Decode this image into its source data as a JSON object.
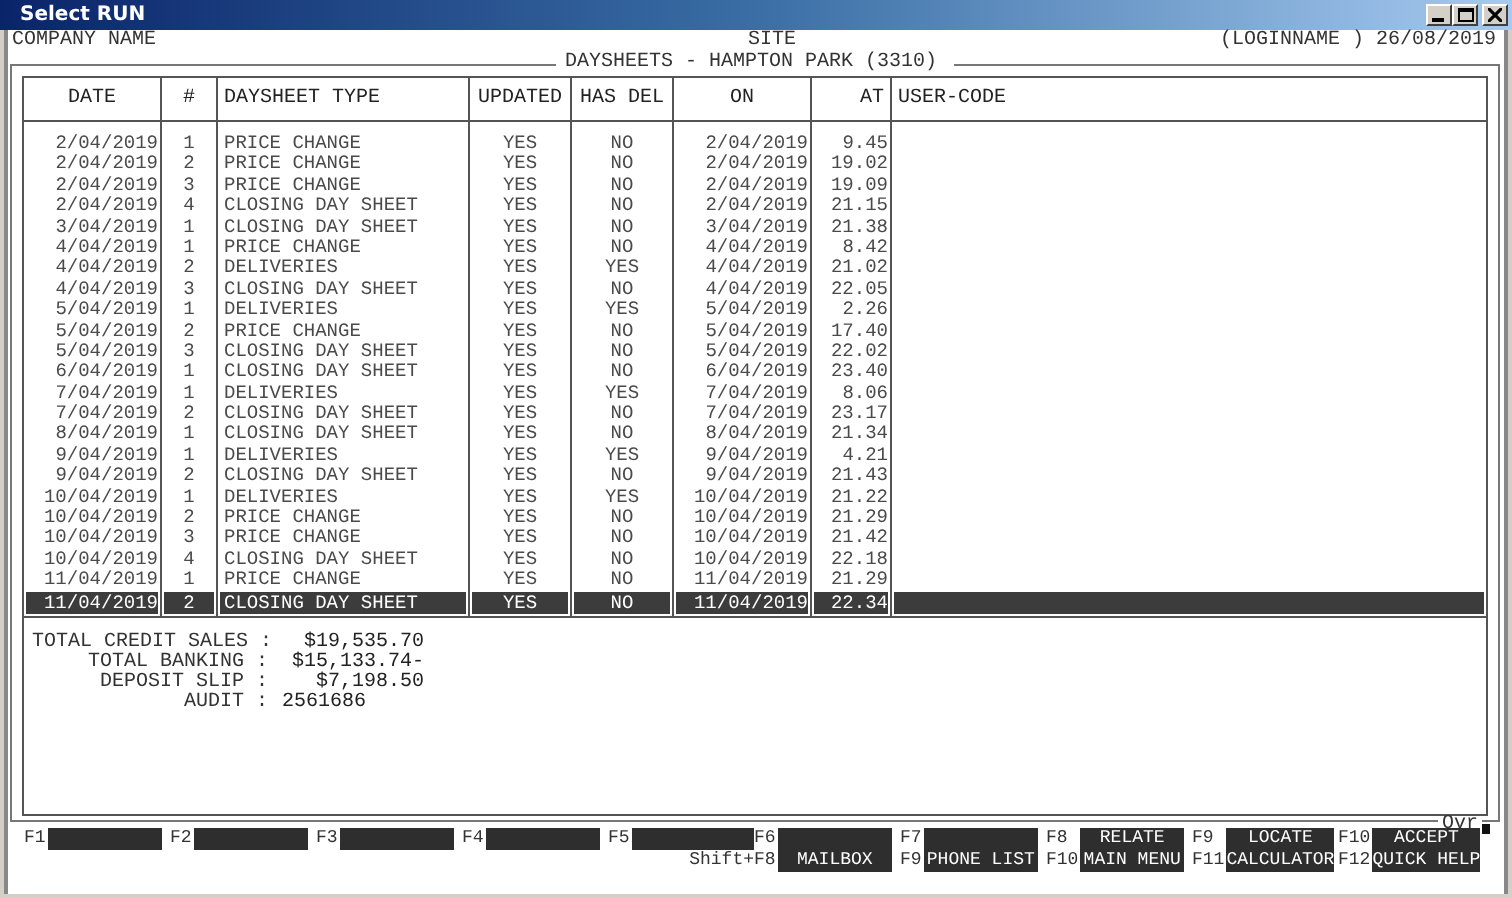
{
  "window": {
    "title": "Select RUN"
  },
  "header": {
    "company": "COMPANY NAME",
    "site": "SITE",
    "user": "(LOGINNAME )",
    "date": "26/08/2019"
  },
  "panel": {
    "title": "DAYSHEETS - HAMPTON PARK (3310)",
    "mode": "Ovr",
    "columns": [
      "DATE",
      "#",
      "DAYSHEET TYPE",
      "UPDATED",
      "HAS DEL",
      "ON",
      "AT",
      "USER-CODE"
    ],
    "rows": [
      {
        "date": "2/04/2019",
        "number": "1",
        "type": "PRICE CHANGE",
        "updated": "YES",
        "has_del": "NO",
        "on": "2/04/2019",
        "at": "9.45",
        "selected": false
      },
      {
        "date": "2/04/2019",
        "number": "2",
        "type": "PRICE CHANGE",
        "updated": "YES",
        "has_del": "NO",
        "on": "2/04/2019",
        "at": "19.02",
        "selected": false
      },
      {
        "date": "2/04/2019",
        "number": "3",
        "type": "PRICE CHANGE",
        "updated": "YES",
        "has_del": "NO",
        "on": "2/04/2019",
        "at": "19.09",
        "selected": false
      },
      {
        "date": "2/04/2019",
        "number": "4",
        "type": "CLOSING DAY SHEET",
        "updated": "YES",
        "has_del": "NO",
        "on": "2/04/2019",
        "at": "21.15",
        "selected": false
      },
      {
        "date": "3/04/2019",
        "number": "1",
        "type": "CLOSING DAY SHEET",
        "updated": "YES",
        "has_del": "NO",
        "on": "3/04/2019",
        "at": "21.38",
        "selected": false
      },
      {
        "date": "4/04/2019",
        "number": "1",
        "type": "PRICE CHANGE",
        "updated": "YES",
        "has_del": "NO",
        "on": "4/04/2019",
        "at": "8.42",
        "selected": false
      },
      {
        "date": "4/04/2019",
        "number": "2",
        "type": "DELIVERIES",
        "updated": "YES",
        "has_del": "YES",
        "on": "4/04/2019",
        "at": "21.02",
        "selected": false
      },
      {
        "date": "4/04/2019",
        "number": "3",
        "type": "CLOSING DAY SHEET",
        "updated": "YES",
        "has_del": "NO",
        "on": "4/04/2019",
        "at": "22.05",
        "selected": false
      },
      {
        "date": "5/04/2019",
        "number": "1",
        "type": "DELIVERIES",
        "updated": "YES",
        "has_del": "YES",
        "on": "5/04/2019",
        "at": "2.26",
        "selected": false
      },
      {
        "date": "5/04/2019",
        "number": "2",
        "type": "PRICE CHANGE",
        "updated": "YES",
        "has_del": "NO",
        "on": "5/04/2019",
        "at": "17.40",
        "selected": false
      },
      {
        "date": "5/04/2019",
        "number": "3",
        "type": "CLOSING DAY SHEET",
        "updated": "YES",
        "has_del": "NO",
        "on": "5/04/2019",
        "at": "22.02",
        "selected": false
      },
      {
        "date": "6/04/2019",
        "number": "1",
        "type": "CLOSING DAY SHEET",
        "updated": "YES",
        "has_del": "NO",
        "on": "6/04/2019",
        "at": "23.40",
        "selected": false
      },
      {
        "date": "7/04/2019",
        "number": "1",
        "type": "DELIVERIES",
        "updated": "YES",
        "has_del": "YES",
        "on": "7/04/2019",
        "at": "8.06",
        "selected": false
      },
      {
        "date": "7/04/2019",
        "number": "2",
        "type": "CLOSING DAY SHEET",
        "updated": "YES",
        "has_del": "NO",
        "on": "7/04/2019",
        "at": "23.17",
        "selected": false
      },
      {
        "date": "8/04/2019",
        "number": "1",
        "type": "CLOSING DAY SHEET",
        "updated": "YES",
        "has_del": "NO",
        "on": "8/04/2019",
        "at": "21.34",
        "selected": false
      },
      {
        "date": "9/04/2019",
        "number": "1",
        "type": "DELIVERIES",
        "updated": "YES",
        "has_del": "YES",
        "on": "9/04/2019",
        "at": "4.21",
        "selected": false
      },
      {
        "date": "9/04/2019",
        "number": "2",
        "type": "CLOSING DAY SHEET",
        "updated": "YES",
        "has_del": "NO",
        "on": "9/04/2019",
        "at": "21.43",
        "selected": false
      },
      {
        "date": "10/04/2019",
        "number": "1",
        "type": "DELIVERIES",
        "updated": "YES",
        "has_del": "YES",
        "on": "10/04/2019",
        "at": "21.22",
        "selected": false
      },
      {
        "date": "10/04/2019",
        "number": "2",
        "type": "PRICE CHANGE",
        "updated": "YES",
        "has_del": "NO",
        "on": "10/04/2019",
        "at": "21.29",
        "selected": false
      },
      {
        "date": "10/04/2019",
        "number": "3",
        "type": "PRICE CHANGE",
        "updated": "YES",
        "has_del": "NO",
        "on": "10/04/2019",
        "at": "21.42",
        "selected": false
      },
      {
        "date": "10/04/2019",
        "number": "4",
        "type": "CLOSING DAY SHEET",
        "updated": "YES",
        "has_del": "NO",
        "on": "10/04/2019",
        "at": "22.18",
        "selected": false
      },
      {
        "date": "11/04/2019",
        "number": "1",
        "type": "PRICE CHANGE",
        "updated": "YES",
        "has_del": "NO",
        "on": "11/04/2019",
        "at": "21.29",
        "selected": false
      },
      {
        "date": "11/04/2019",
        "number": "2",
        "type": "CLOSING DAY SHEET",
        "updated": "YES",
        "has_del": "NO",
        "on": "11/04/2019",
        "at": "22.34",
        "selected": true
      }
    ],
    "summary": [
      {
        "label": "TOTAL CREDIT SALES :",
        "value": "$19,535.70",
        "kind": "money"
      },
      {
        "label": "TOTAL BANKING :",
        "value": "$15,133.74-",
        "kind": "money"
      },
      {
        "label": "DEPOSIT SLIP :",
        "value": "$7,198.50",
        "kind": "money"
      },
      {
        "label": "AUDIT :",
        "value": "2561686",
        "kind": "number"
      }
    ]
  },
  "function_keys": {
    "shift_prefix": "Shift+",
    "keys": [
      {
        "key": "F1"
      },
      {
        "key": "F2"
      },
      {
        "key": "F3"
      },
      {
        "key": "F4"
      },
      {
        "key": "F5"
      },
      {
        "key": "F6",
        "shift_key": "F8",
        "shift_label": "MAILBOX"
      },
      {
        "key": "F7",
        "shift_key": "F9",
        "shift_label": "PHONE LIST"
      },
      {
        "key": "F8",
        "label": "RELATE",
        "shift_key": "F10",
        "shift_label": "MAIN MENU"
      },
      {
        "key": "F9",
        "label": "LOCATE",
        "shift_key": "F11",
        "shift_label": "CALCULATOR"
      },
      {
        "key": "F10",
        "label": "ACCEPT",
        "shift_key": "F12",
        "shift_label": "QUICK HELP"
      }
    ]
  }
}
